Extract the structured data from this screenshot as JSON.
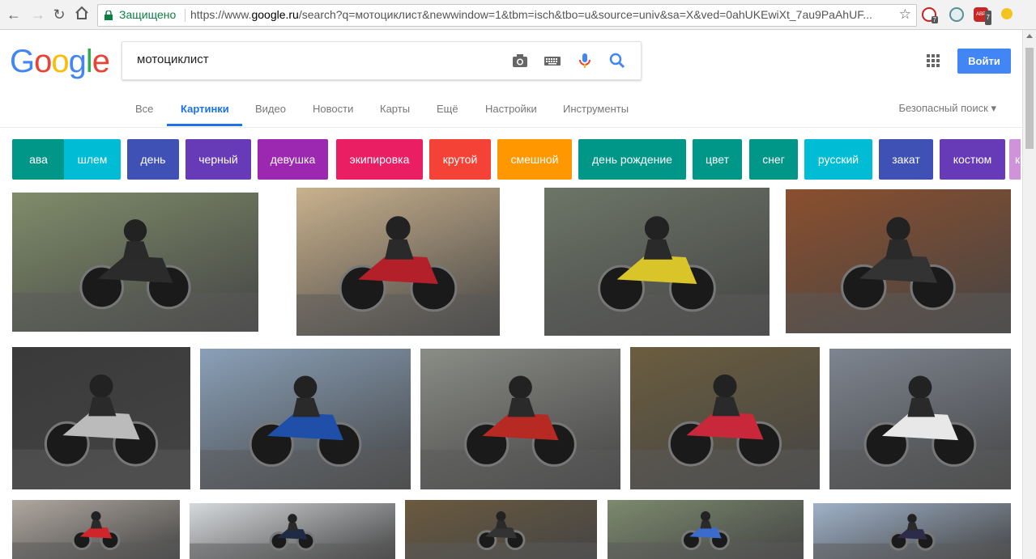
{
  "browser": {
    "secure_label": "Защищено",
    "url_prefix": "https://www.",
    "url_host": "google.ru",
    "url_path": "/search?q=мотоциклист&newwindow=1&tbm=isch&tbo=u&source=univ&sa=X&ved=0ahUKEwiXt_7au9PaAhUF...",
    "ext_badges": [
      "7",
      "7"
    ],
    "ext_abp_label": "ABP"
  },
  "logo": {
    "letters": [
      "G",
      "o",
      "o",
      "g",
      "l",
      "e"
    ],
    "colors": [
      "#4285f4",
      "#ea4335",
      "#fbbc05",
      "#4285f4",
      "#34a853",
      "#ea4335"
    ]
  },
  "search": {
    "query": "мотоциклист"
  },
  "header": {
    "signin_label": "Войти"
  },
  "tabs": [
    "Все",
    "Картинки",
    "Видео",
    "Новости",
    "Карты",
    "Ещё",
    "Настройки",
    "Инструменты"
  ],
  "active_tab": "Картинки",
  "safe_search": "Безопасный поиск",
  "chips": [
    {
      "label": "ава",
      "color": "#009688"
    },
    {
      "label": "шлем",
      "color": "#00bcd4"
    },
    {
      "label": "день",
      "color": "#3f51b5"
    },
    {
      "label": "черный",
      "color": "#673ab7"
    },
    {
      "label": "девушка",
      "color": "#9c27b0"
    },
    {
      "label": "экипировка",
      "color": "#e91e63"
    },
    {
      "label": "крутой",
      "color": "#f44336"
    },
    {
      "label": "смешной",
      "color": "#ff9800"
    },
    {
      "label": "день рождение",
      "color": "#009688"
    },
    {
      "label": "цвет",
      "color": "#009688"
    },
    {
      "label": "снег",
      "color": "#009688"
    },
    {
      "label": "русский",
      "color": "#00bcd4"
    },
    {
      "label": "закат",
      "color": "#3f51b5"
    },
    {
      "label": "костюм",
      "color": "#673ab7"
    },
    {
      "label": "к",
      "color": "#ce93d8"
    }
  ],
  "image_results": [
    {
      "bg": "#7f8c6a",
      "accent": "#2b2b2b"
    },
    {
      "bg": "#c9b18d",
      "accent": "#b3202a"
    },
    {
      "bg": "#6d7567",
      "accent": "#d9c52a"
    },
    {
      "bg": "#8b4f2e",
      "accent": "#333333"
    },
    {
      "bg": "#3a3a3a",
      "accent": "#bbbbbb"
    },
    {
      "bg": "#8aa0b8",
      "accent": "#1f4fa8"
    },
    {
      "bg": "#8a8c86",
      "accent": "#b72a24"
    },
    {
      "bg": "#6b5d3f",
      "accent": "#c9283b"
    },
    {
      "bg": "#7e8590",
      "accent": "#e8e8e8"
    },
    {
      "bg": "#b0a8a0",
      "accent": "#d0262b"
    },
    {
      "bg": "#d6d9dc",
      "accent": "#1f2a44"
    },
    {
      "bg": "#6b5a3f",
      "accent": "#333333"
    },
    {
      "bg": "#7c8a6e",
      "accent": "#3b6ccb"
    },
    {
      "bg": "#9fb1c8",
      "accent": "#2c2c4a"
    }
  ]
}
